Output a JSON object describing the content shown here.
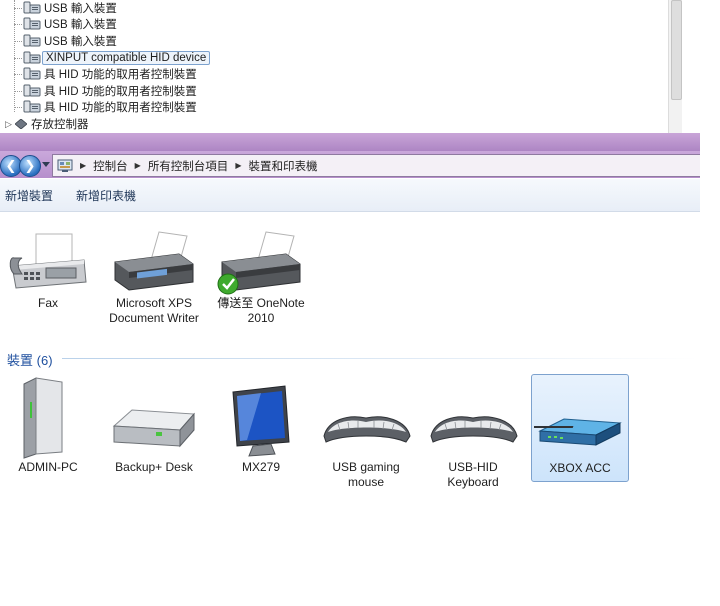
{
  "device_tree": {
    "rows": [
      {
        "label": "USB 輸入裝置"
      },
      {
        "label": "USB 輸入裝置"
      },
      {
        "label": "USB 輸入裝置"
      },
      {
        "label": "XINPUT compatible HID device",
        "selected": true
      },
      {
        "label": "具 HID 功能的取用者控制裝置"
      },
      {
        "label": "具 HID 功能的取用者控制裝置"
      },
      {
        "label": "具 HID 功能的取用者控制裝置"
      }
    ],
    "storage_label": "存放控制器"
  },
  "explorer": {
    "breadcrumb": [
      "控制台",
      "所有控制台項目",
      "裝置和印表機"
    ],
    "toolbar": {
      "add_device": "新增裝置",
      "add_printer": "新增印表機"
    },
    "printers": [
      {
        "label": "Fax",
        "icon": "fax-icon"
      },
      {
        "label": "Microsoft XPS Document Writer",
        "icon": "printer-icon"
      },
      {
        "label": "傳送至 OneNote 2010",
        "icon": "printer-default-icon"
      }
    ],
    "devices_group": {
      "title": "裝置",
      "count": "(6)"
    },
    "devices": [
      {
        "label": "ADMIN-PC",
        "icon": "computer-tower-icon"
      },
      {
        "label": "Backup+  Desk",
        "icon": "external-drive-icon"
      },
      {
        "label": "MX279",
        "icon": "monitor-icon"
      },
      {
        "label": "USB gaming mouse",
        "icon": "keyboard-icon"
      },
      {
        "label": "USB-HID Keyboard",
        "icon": "keyboard-icon"
      },
      {
        "label": "XBOX ACC",
        "icon": "network-device-icon",
        "selected": true
      }
    ]
  }
}
